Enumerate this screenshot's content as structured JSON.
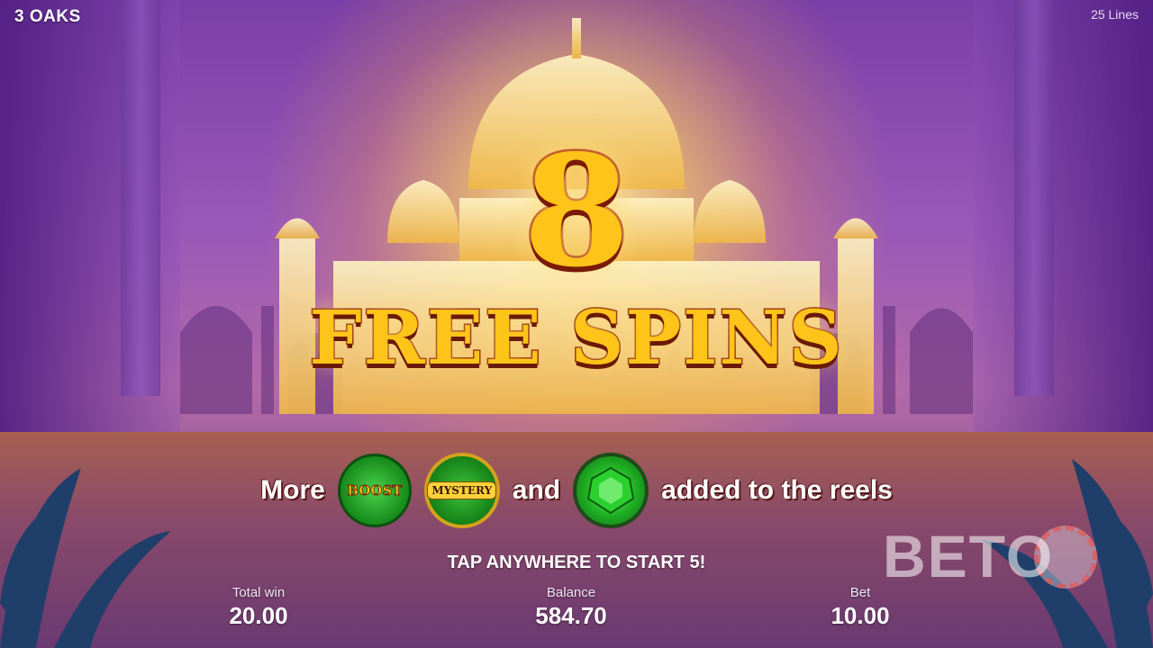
{
  "header": {
    "brand": "3 OAKS",
    "lines": "25 Lines"
  },
  "popup": {
    "count": "8",
    "title": "FREE SPINS",
    "features": {
      "prefix": "More",
      "boost_label": "BOOST",
      "mystery_label": "MYSTERY",
      "conjunction": "and",
      "suffix": "added to the reels"
    },
    "tap_prompt": "TAP ANYWHERE TO START 5!"
  },
  "stats": {
    "total_win": {
      "label": "Total win",
      "value": "20.00"
    },
    "balance": {
      "label": "Balance",
      "value": "584.70"
    },
    "bet": {
      "label": "Bet",
      "value": "10.00"
    }
  },
  "watermark": {
    "text": "BETO"
  },
  "icons": [
    "boost-symbol-icon",
    "mystery-symbol-icon",
    "emerald-gem-icon"
  ],
  "colors": {
    "accent_gold": "#ffc419",
    "text_outline": "#a52a12",
    "background": "#7a3fa8"
  }
}
